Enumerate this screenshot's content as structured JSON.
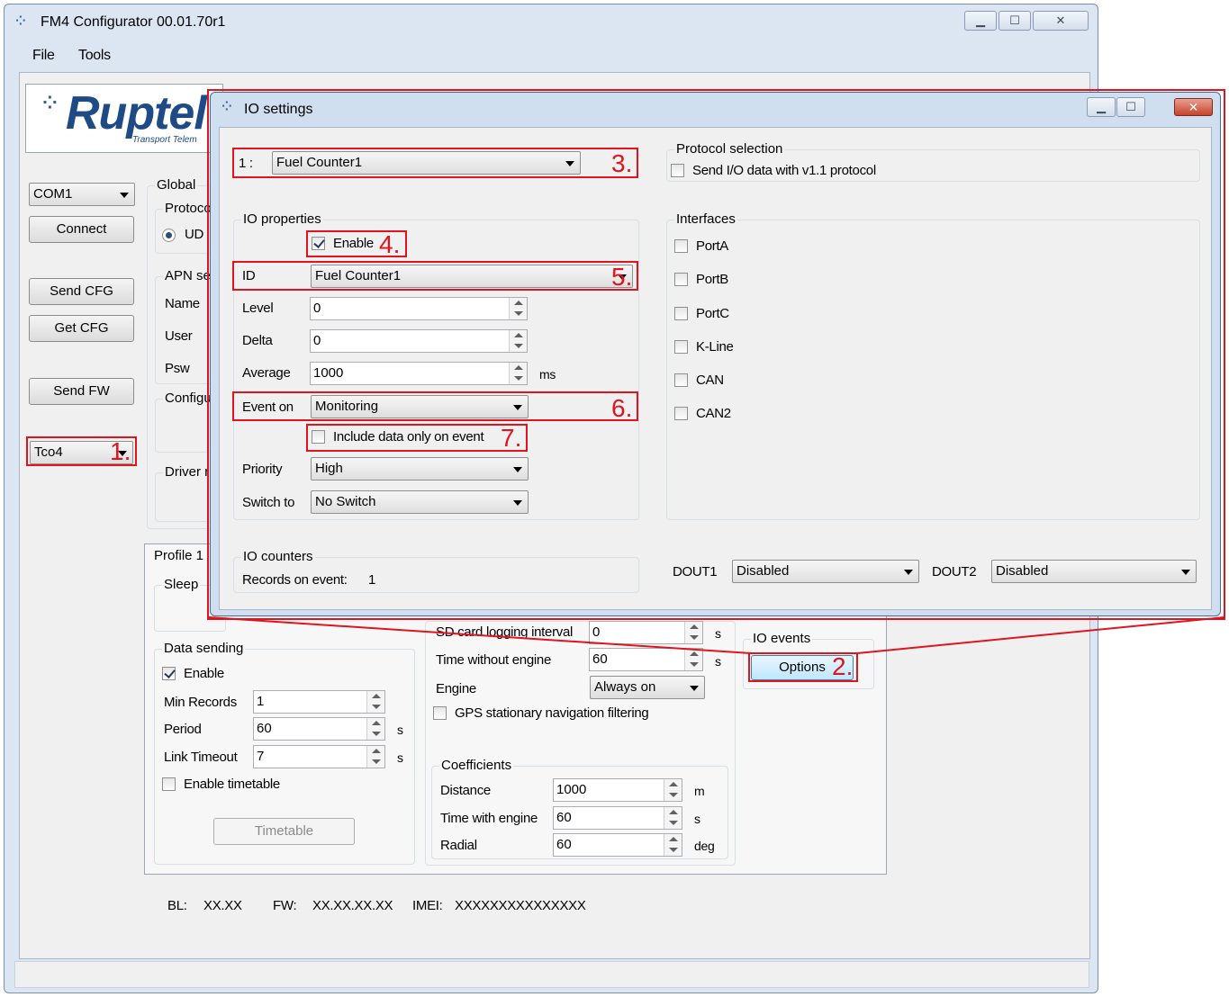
{
  "app": {
    "title": "FM4 Configurator 00.01.70r1",
    "menu": [
      "File",
      "Tools"
    ],
    "logo_text": "Ruptel",
    "logo_sub": "Transport Telem",
    "com_port": "COM1",
    "buttons": {
      "connect": "Connect",
      "send_cfg": "Send CFG",
      "get_cfg": "Get CFG",
      "send_fw": "Send FW"
    },
    "tco_select": "Tco4",
    "global": {
      "title": "Global",
      "protocol_label": "Protoco",
      "udp_label": "UD",
      "apn_label": "APN se",
      "name_label": "Name",
      "user_label": "User",
      "psw_label": "Psw",
      "config_label": "Configu",
      "driver_label": "Driver r"
    },
    "profile": {
      "tab": "Profile 1",
      "sleep_label": "Sleep",
      "data_sending": {
        "title": "Data sending",
        "enable": "Enable",
        "min_records_label": "Min Records",
        "min_records": "1",
        "period_label": "Period",
        "period": "60",
        "period_unit": "s",
        "link_timeout_label": "Link Timeout",
        "link_timeout": "7",
        "link_timeout_unit": "s",
        "enable_timetable": "Enable timetable",
        "timetable_button": "Timetable"
      },
      "sd_logging_label": "SD card logging interval",
      "sd_logging": "0",
      "sd_logging_unit": "s",
      "time_without_engine_label": "Time without engine",
      "time_without_engine": "60",
      "time_without_engine_unit": "s",
      "engine_label": "Engine",
      "engine_value": "Always on",
      "gps_filtering": "GPS stationary navigation filtering",
      "coefficients": {
        "title": "Coefficients",
        "distance_label": "Distance",
        "distance": "1000",
        "distance_unit": "m",
        "time_with_engine_label": "Time with engine",
        "time_with_engine": "60",
        "time_with_engine_unit": "s",
        "radial_label": "Radial",
        "radial": "60",
        "radial_unit": "deg"
      },
      "io_events": {
        "title": "IO events",
        "options_button": "Options"
      }
    },
    "info": {
      "bl_label": "BL:",
      "bl": "XX.XX",
      "fw_label": "FW:",
      "fw": "XX.XX.XX.XX",
      "imei_label": "IMEI:",
      "imei": "XXXXXXXXXXXXXXX"
    }
  },
  "dialog": {
    "title": "IO settings",
    "io_index": "1 :",
    "io_select": "Fuel Counter1",
    "io_properties": {
      "title": "IO properties",
      "enable": "Enable",
      "id_label": "ID",
      "id_value": "Fuel Counter1",
      "level_label": "Level",
      "level": "0",
      "delta_label": "Delta",
      "delta": "0",
      "average_label": "Average",
      "average": "1000",
      "average_unit": "ms",
      "event_on_label": "Event on",
      "event_on": "Monitoring",
      "include_data": "Include data only on event",
      "priority_label": "Priority",
      "priority": "High",
      "switch_to_label": "Switch to",
      "switch_to": "No Switch"
    },
    "protocol": {
      "title": "Protocol selection",
      "send_v11": "Send I/O data with v1.1 protocol"
    },
    "interfaces": {
      "title": "Interfaces",
      "items": [
        "PortA",
        "PortB",
        "PortC",
        "K-Line",
        "CAN",
        "CAN2"
      ]
    },
    "io_counters": {
      "title": "IO counters",
      "records_label": "Records on event:",
      "records": "1"
    },
    "dout1_label": "DOUT1",
    "dout1": "Disabled",
    "dout2_label": "DOUT2",
    "dout2": "Disabled"
  },
  "annotations": {
    "colors": {
      "highlight": "#e0141e"
    },
    "numbers": [
      "1.",
      "2.",
      "3.",
      "4.",
      "5.",
      "6.",
      "7."
    ]
  }
}
